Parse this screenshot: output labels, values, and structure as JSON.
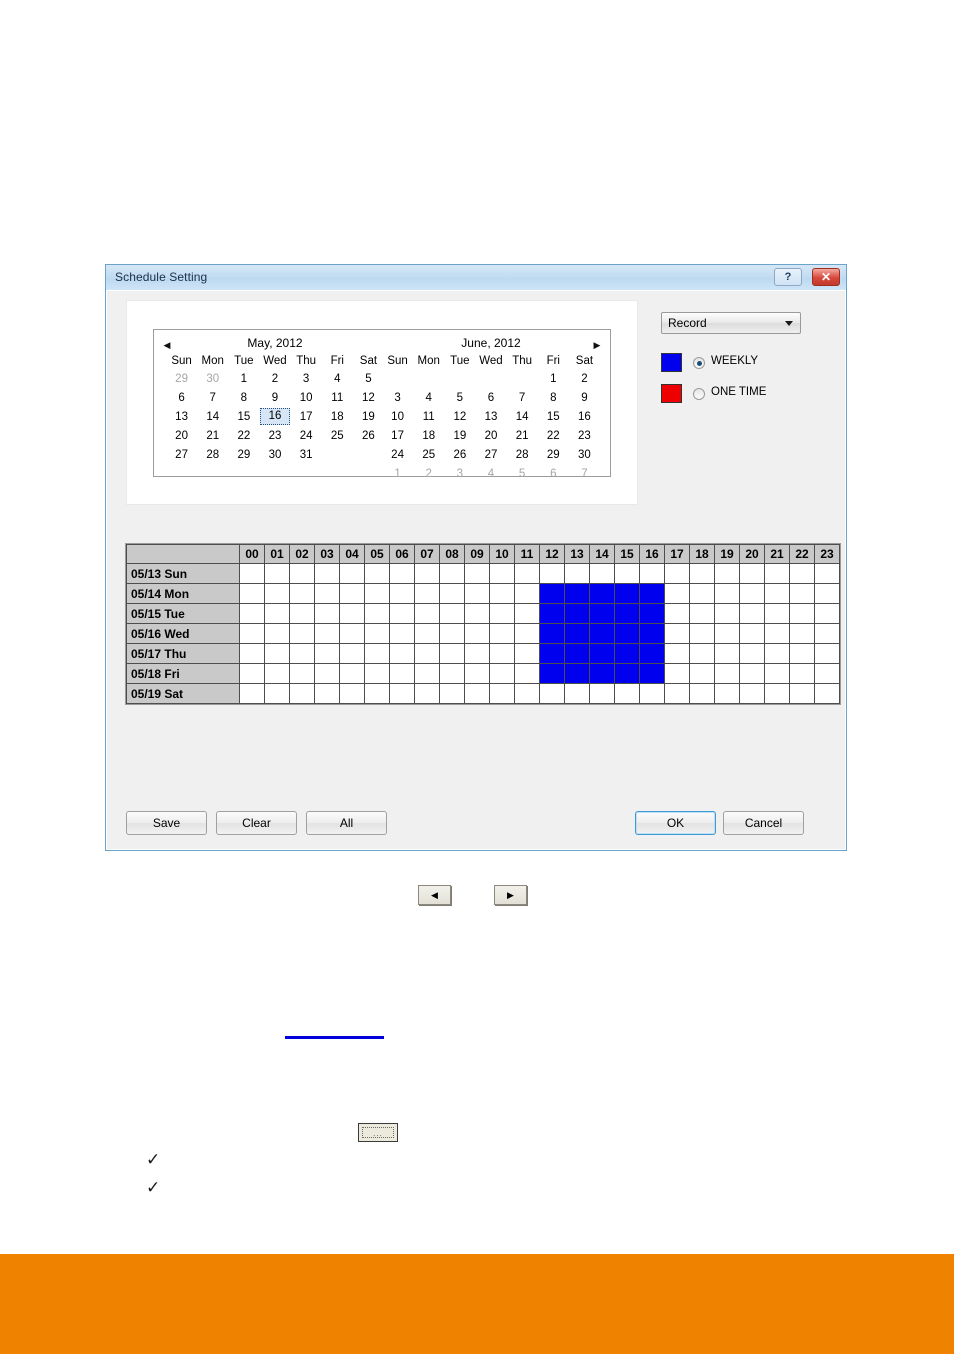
{
  "window": {
    "title": "Schedule Setting",
    "help_label": "?",
    "close_label": "✕"
  },
  "calendar": {
    "prev_arrow": "◀",
    "next_arrow": "▶",
    "weekday_headers": [
      "Sun",
      "Mon",
      "Tue",
      "Wed",
      "Thu",
      "Fri",
      "Sat"
    ],
    "months": [
      {
        "title": "May, 2012",
        "weeks": [
          [
            {
              "d": "29",
              "muted": true
            },
            {
              "d": "30",
              "muted": true
            },
            {
              "d": "1"
            },
            {
              "d": "2"
            },
            {
              "d": "3"
            },
            {
              "d": "4"
            },
            {
              "d": "5"
            }
          ],
          [
            {
              "d": "6"
            },
            {
              "d": "7"
            },
            {
              "d": "8"
            },
            {
              "d": "9"
            },
            {
              "d": "10"
            },
            {
              "d": "11"
            },
            {
              "d": "12"
            }
          ],
          [
            {
              "d": "13"
            },
            {
              "d": "14"
            },
            {
              "d": "15"
            },
            {
              "d": "16",
              "selected": true
            },
            {
              "d": "17"
            },
            {
              "d": "18"
            },
            {
              "d": "19"
            }
          ],
          [
            {
              "d": "20"
            },
            {
              "d": "21"
            },
            {
              "d": "22"
            },
            {
              "d": "23"
            },
            {
              "d": "24"
            },
            {
              "d": "25"
            },
            {
              "d": "26"
            }
          ],
          [
            {
              "d": "27"
            },
            {
              "d": "28"
            },
            {
              "d": "29"
            },
            {
              "d": "30"
            },
            {
              "d": "31"
            },
            {
              "d": ""
            },
            {
              "d": ""
            }
          ],
          [
            {
              "d": ""
            },
            {
              "d": ""
            },
            {
              "d": ""
            },
            {
              "d": ""
            },
            {
              "d": ""
            },
            {
              "d": ""
            },
            {
              "d": ""
            }
          ]
        ]
      },
      {
        "title": "June, 2012",
        "weeks": [
          [
            {
              "d": ""
            },
            {
              "d": ""
            },
            {
              "d": ""
            },
            {
              "d": ""
            },
            {
              "d": ""
            },
            {
              "d": "1"
            },
            {
              "d": "2"
            }
          ],
          [
            {
              "d": "3"
            },
            {
              "d": "4"
            },
            {
              "d": "5"
            },
            {
              "d": "6"
            },
            {
              "d": "7"
            },
            {
              "d": "8"
            },
            {
              "d": "9"
            }
          ],
          [
            {
              "d": "10"
            },
            {
              "d": "11"
            },
            {
              "d": "12"
            },
            {
              "d": "13"
            },
            {
              "d": "14"
            },
            {
              "d": "15"
            },
            {
              "d": "16"
            }
          ],
          [
            {
              "d": "17"
            },
            {
              "d": "18"
            },
            {
              "d": "19"
            },
            {
              "d": "20"
            },
            {
              "d": "21"
            },
            {
              "d": "22"
            },
            {
              "d": "23"
            }
          ],
          [
            {
              "d": "24"
            },
            {
              "d": "25"
            },
            {
              "d": "26"
            },
            {
              "d": "27"
            },
            {
              "d": "28"
            },
            {
              "d": "29"
            },
            {
              "d": "30"
            }
          ],
          [
            {
              "d": "1",
              "muted": true
            },
            {
              "d": "2",
              "muted": true
            },
            {
              "d": "3",
              "muted": true
            },
            {
              "d": "4",
              "muted": true
            },
            {
              "d": "5",
              "muted": true
            },
            {
              "d": "6",
              "muted": true
            },
            {
              "d": "7",
              "muted": true
            }
          ]
        ]
      }
    ]
  },
  "type_select": {
    "value": "Record",
    "options": [
      "Record"
    ]
  },
  "legend": [
    {
      "label": "WEEKLY",
      "color": "#0000ee",
      "selected": true
    },
    {
      "label": "ONE TIME",
      "color": "#ee0000",
      "selected": false
    }
  ],
  "grid": {
    "hours": [
      "00",
      "01",
      "02",
      "03",
      "04",
      "05",
      "06",
      "07",
      "08",
      "09",
      "10",
      "11",
      "12",
      "13",
      "14",
      "15",
      "16",
      "17",
      "18",
      "19",
      "20",
      "21",
      "22",
      "23"
    ],
    "rows": [
      {
        "label": "05/13 Sun",
        "on": []
      },
      {
        "label": "05/14 Mon",
        "on": [
          12,
          13,
          14,
          15,
          16
        ]
      },
      {
        "label": "05/15 Tue",
        "on": [
          12,
          13,
          14,
          15,
          16
        ]
      },
      {
        "label": "05/16 Wed",
        "on": [
          12,
          13,
          14,
          15,
          16
        ]
      },
      {
        "label": "05/17 Thu",
        "on": [
          12,
          13,
          14,
          15,
          16
        ]
      },
      {
        "label": "05/18 Fri",
        "on": [
          12,
          13,
          14,
          15,
          16
        ]
      },
      {
        "label": "05/19 Sat",
        "on": []
      }
    ]
  },
  "buttons": {
    "save": "Save",
    "clear": "Clear",
    "all": "All",
    "ok": "OK",
    "cancel": "Cancel"
  },
  "page_extras": {
    "mini_prev": "◀",
    "mini_next": "▶",
    "dots_label": "...",
    "check_mark": "✓"
  },
  "colors": {
    "weekly": "#0000ee",
    "one_time": "#ee0000",
    "accent_bar": "#ef8300",
    "titlebar": "#c3ddf2"
  }
}
